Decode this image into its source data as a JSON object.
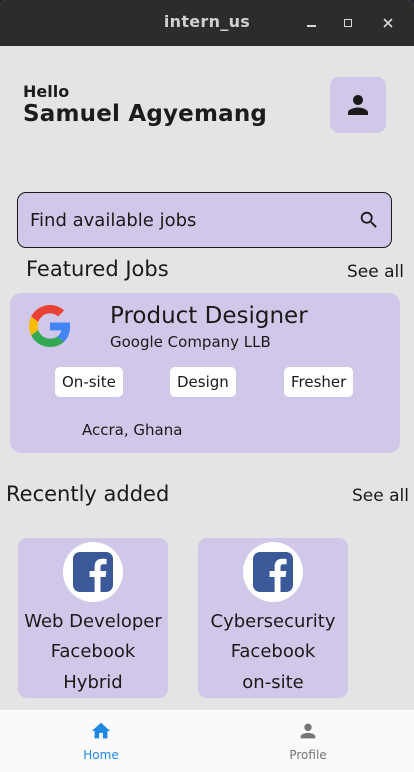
{
  "window": {
    "title": "intern_us"
  },
  "header": {
    "greeting": "Hello",
    "user_name": "Samuel Agyemang"
  },
  "search": {
    "placeholder": "Find available jobs"
  },
  "featured": {
    "title": "Featured Jobs",
    "see_all": "See all",
    "job": {
      "title": "Product Designer",
      "company": "Google Company LLB",
      "tags": [
        "On-site",
        "Design",
        "Fresher"
      ],
      "location": "Accra, Ghana"
    }
  },
  "recent": {
    "title": "Recently added",
    "see_all": "See all",
    "items": [
      {
        "title": "Web Developer",
        "company": "Facebook",
        "mode": "Hybrid"
      },
      {
        "title": "Cybersecurity",
        "company": "Facebook",
        "mode": "on-site"
      }
    ]
  },
  "bottom_nav": {
    "items": [
      {
        "label": "Home",
        "icon": "home-icon",
        "active": true
      },
      {
        "label": "Profile",
        "icon": "person-icon",
        "active": false
      }
    ]
  },
  "colors": {
    "card": "#d1c7e8",
    "background": "#e4e4e4",
    "titlebar": "#2c2c2c",
    "active_nav": "#1e88e5",
    "inactive_nav": "#757575",
    "facebook": "#3b5998"
  }
}
